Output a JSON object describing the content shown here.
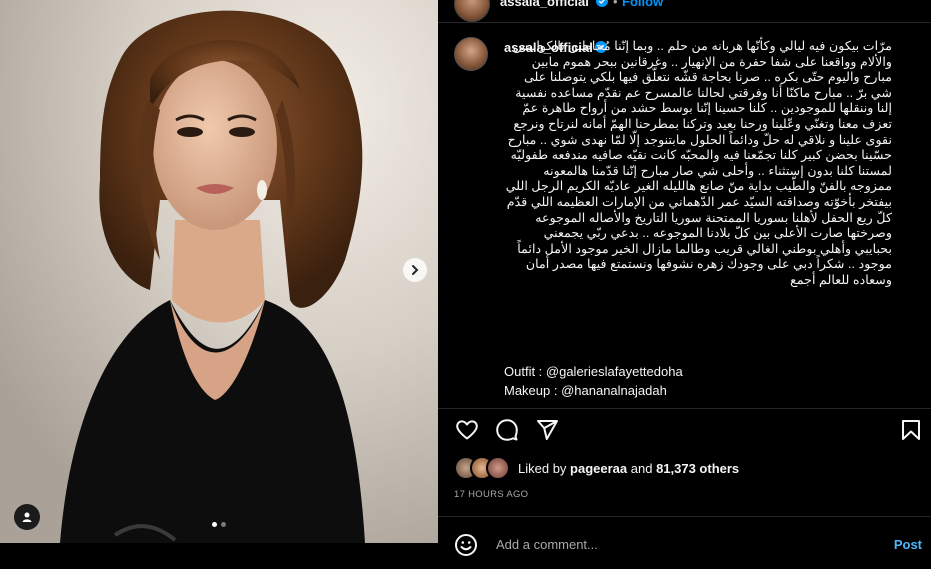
{
  "header": {
    "username": "assala_official",
    "separator": "•",
    "follow_label": "Follow",
    "more_label": "•••"
  },
  "caption": {
    "username": "assala_official",
    "text": "مرّات بيكون فيه ليالي وكأنّها هربانه من حلم .. وبما إنّنا مُحاطين بالكوابيس والألام وواقعنا على شفا حفرة من الإنهيار .. وغرقانين ببحر هموم مابين مبارح واليوم حتّى بكره .. صرنا بحاجة قشّه نتعلّق فيها بلكي يتوصلنا على شي برّ .. مبارح ماكنّا أنا وفرقتي لحالنا عالمسرح عم نقدّم مساعده نفسية إلنا وننقلها للموجودين .. كلنا حسينا إنّنا بوسط حشد من أرواح طاهرة عمّ تعزف معنا وتغنّي وعّلينا ورحنا بعيد وتركنا بمطرحنا الهمّ أمانه لنرتاح ونرجع نقوى علينا و نلاقي له حلّ ودائماً الحلول مابتنوجد إلّا لمّا نهدى شوي .. مبارح حسّينا بحضن كبير كلنا تجمّعنا فيه والمحبّه كانت نقيّه صافيه مندفعه طفوليّه لمستنا كلنا بدون إستثناء .. وأحلى شي صار مبارح إنّنا قدّمنا هالمعونه ممزوجه بالفنّ والطّيب بداية منّ صانع هالليله الغير عاديّه الكريم الرجل اللي بيفتخر بأخوّته وصداقته السيّد عمر الدّهماني من الإمارات العظيمه اللي قدّم كلّ ريع الحفل لأهلنا بسوريا الممتحنة سوريا التاريخ والأصاله الموجوعه وصرختها صارت الأعلى بين كلّ بلادنا الموجوعه .. بدعي ربّي يجمعني بحبايبي وأهلي بوطني الغالي قريب وطالما مازال الخير موجود الأمل دائماً موجود .. شكراً دبي على وجودك زهره نشوفها ونستمتع فيها مصدر أمان وسعاده للعالم أجمع",
    "outfit": "Outfit : @galerieslafayettedoha",
    "makeup": "Makeup : @hananalnajadah"
  },
  "likes": {
    "prefix": "Liked by ",
    "user": "pageeraa",
    "middle": " and ",
    "count": "81,373 others"
  },
  "timestamp": "17 HOURS AGO",
  "comment": {
    "placeholder": "Add a comment...",
    "post_label": "Post"
  },
  "carousel": {
    "slides": 2,
    "active": 1
  },
  "colors": {
    "background": "#000000",
    "text": "#f5f5f5",
    "muted": "#a8a8a8",
    "link": "#0095f6",
    "post_button": "#4db5f9",
    "verified": "#0095f6"
  },
  "icons": [
    "verified-badge-icon",
    "more-icon",
    "heart-icon",
    "comment-icon",
    "share-icon",
    "bookmark-icon",
    "emoji-icon",
    "chevron-right-icon",
    "user-tag-icon"
  ]
}
